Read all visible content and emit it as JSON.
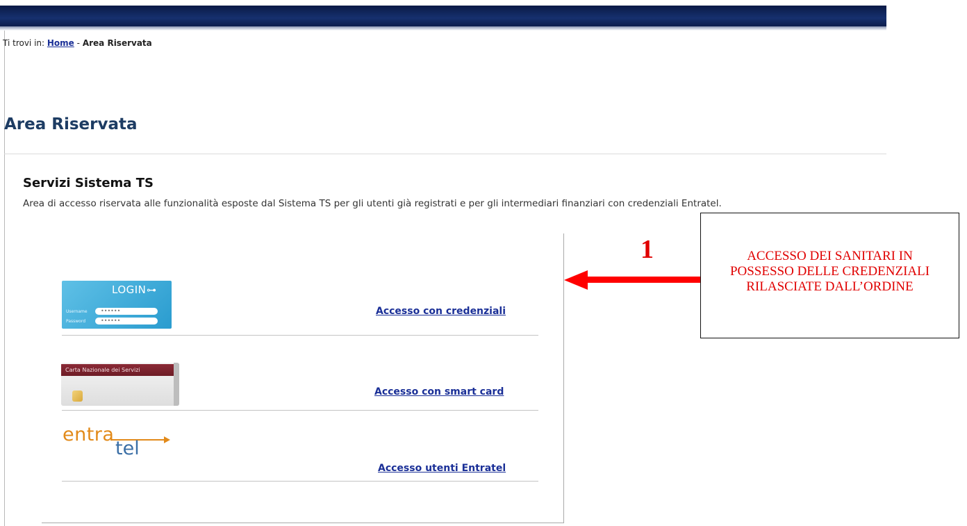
{
  "breadcrumb": {
    "prefix": "Ti trovi in:",
    "home": "Home",
    "separator": "-",
    "current": "Area Riservata"
  },
  "page_title": "Area Riservata",
  "section": {
    "title": "Servizi Sistema TS",
    "description": "Area di accesso riservata alle funzionalità esposte dal Sistema TS per gli utenti già registrati e per gli intermediari finanziari con credenziali Entratel."
  },
  "options": [
    {
      "link": "Accesso con credenziali",
      "logo": {
        "title": "LOGIN",
        "icon": "key-icon",
        "username_label": "Username",
        "password_label": "Password",
        "mask": "••••••"
      }
    },
    {
      "link": "Accesso con smart card",
      "logo": {
        "band": "Carta Nazionale dei Servizi",
        "icon": "chip-icon"
      }
    },
    {
      "link": "Accesso utenti Entratel",
      "logo": {
        "part1": "entra",
        "part2": "tel"
      }
    }
  ],
  "annotation": {
    "number": "1",
    "text": "ACCESSO DEI SANITARI IN POSSESSO DELLE CREDENZIALI RILASCIATE DALL’ORDINE",
    "color": "#e00000"
  },
  "colors": {
    "header": "#16306e",
    "link": "#1a2f97",
    "title": "#1d3c63"
  }
}
